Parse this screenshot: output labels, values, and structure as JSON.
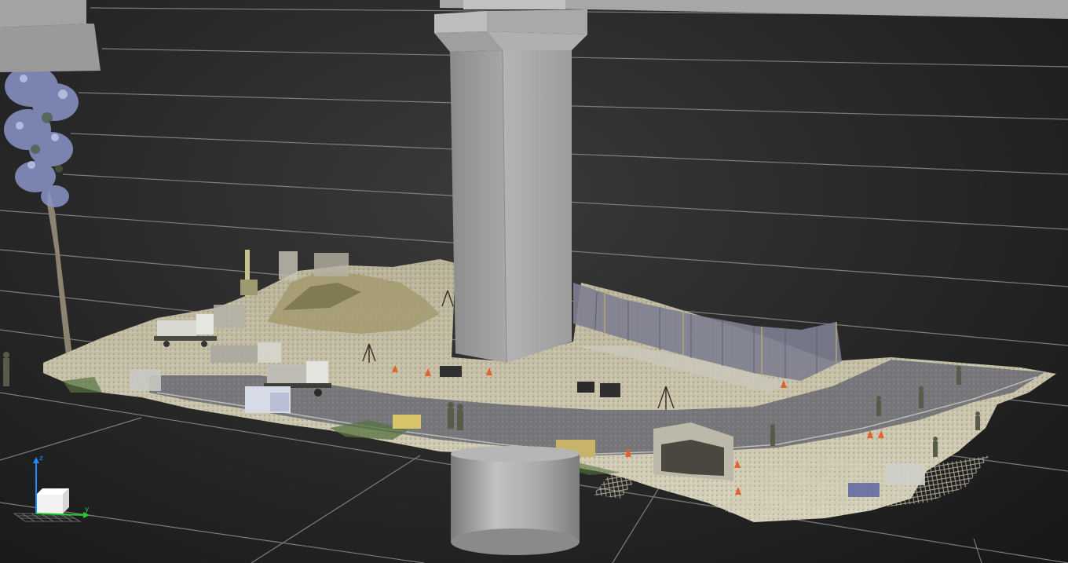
{
  "viewer": {
    "background_color": "#2b2b2b",
    "grid_color": "#8c8c8c",
    "model_color": "#a6a6a6"
  },
  "nav_cube": {
    "z_label": "z",
    "y_label": "y",
    "z_axis_color": "#1e8cff",
    "y_axis_color": "#22cc33",
    "icon": "view-cube-icon"
  }
}
